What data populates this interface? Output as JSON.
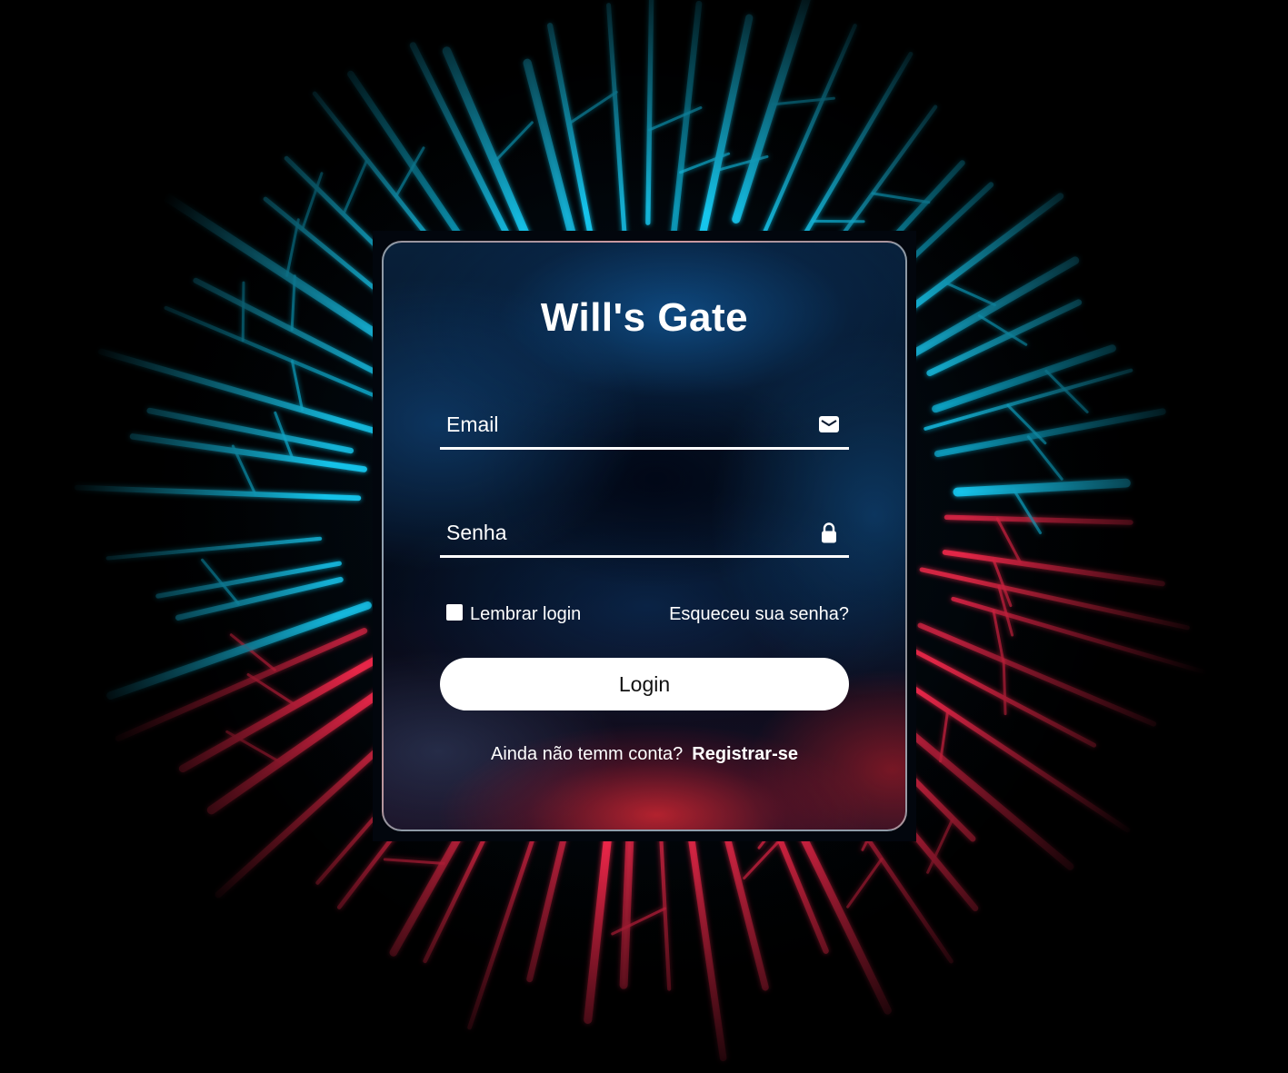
{
  "app": {
    "title": "Will's Gate"
  },
  "form": {
    "email_placeholder": "Email",
    "email_value": "",
    "email_icon": "envelope-icon",
    "password_placeholder": "Senha",
    "password_value": "",
    "password_icon": "lock-icon",
    "remember_label": "Lembrar login",
    "remember_checked": false,
    "forgot_label": "Esqueceu sua senha?",
    "login_label": "Login"
  },
  "footer": {
    "question": "Ainda não temm conta?",
    "register_label": "Registrar-se"
  },
  "colors": {
    "background": "#000000",
    "neon_blue": "#14c8f0",
    "neon_red": "#f0284a",
    "text": "#ffffff",
    "button_bg": "#ffffff",
    "button_text": "#111111"
  }
}
